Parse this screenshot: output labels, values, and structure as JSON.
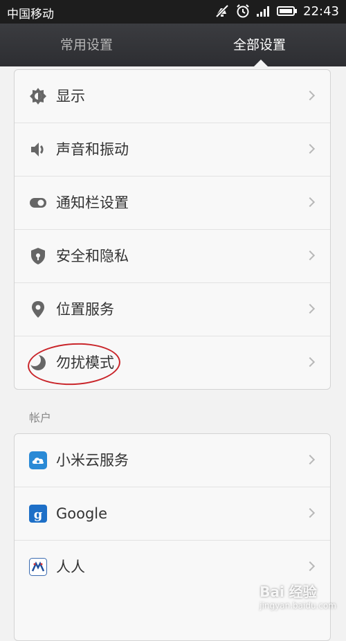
{
  "status_bar": {
    "carrier": "中国移动",
    "time": "22:43"
  },
  "tabs": [
    {
      "label": "常用设置",
      "active": false
    },
    {
      "label": "全部设置",
      "active": true
    }
  ],
  "settings_items": [
    {
      "label": "显示",
      "icon": "brightness-icon"
    },
    {
      "label": "声音和振动",
      "icon": "speaker-icon"
    },
    {
      "label": "通知栏设置",
      "icon": "toggle-icon"
    },
    {
      "label": "安全和隐私",
      "icon": "shield-icon"
    },
    {
      "label": "位置服务",
      "icon": "location-pin-icon"
    },
    {
      "label": "勿扰模式",
      "icon": "moon-icon"
    }
  ],
  "accounts_section": {
    "header": "帐户",
    "items": [
      {
        "label": "小米云服务",
        "icon": "cloud-icon"
      },
      {
        "label": "Google",
        "icon": "google-icon"
      },
      {
        "label": "人人",
        "icon": "renren-icon"
      }
    ]
  },
  "watermark": {
    "text": "Bai 经验",
    "sub": "jingyan.baidu.com"
  },
  "colors": {
    "annotation": "#c9252a",
    "header_bg": "#2d2e32",
    "cloud_blue": "#2a8ad6",
    "google_blue": "#1d6fc7"
  }
}
